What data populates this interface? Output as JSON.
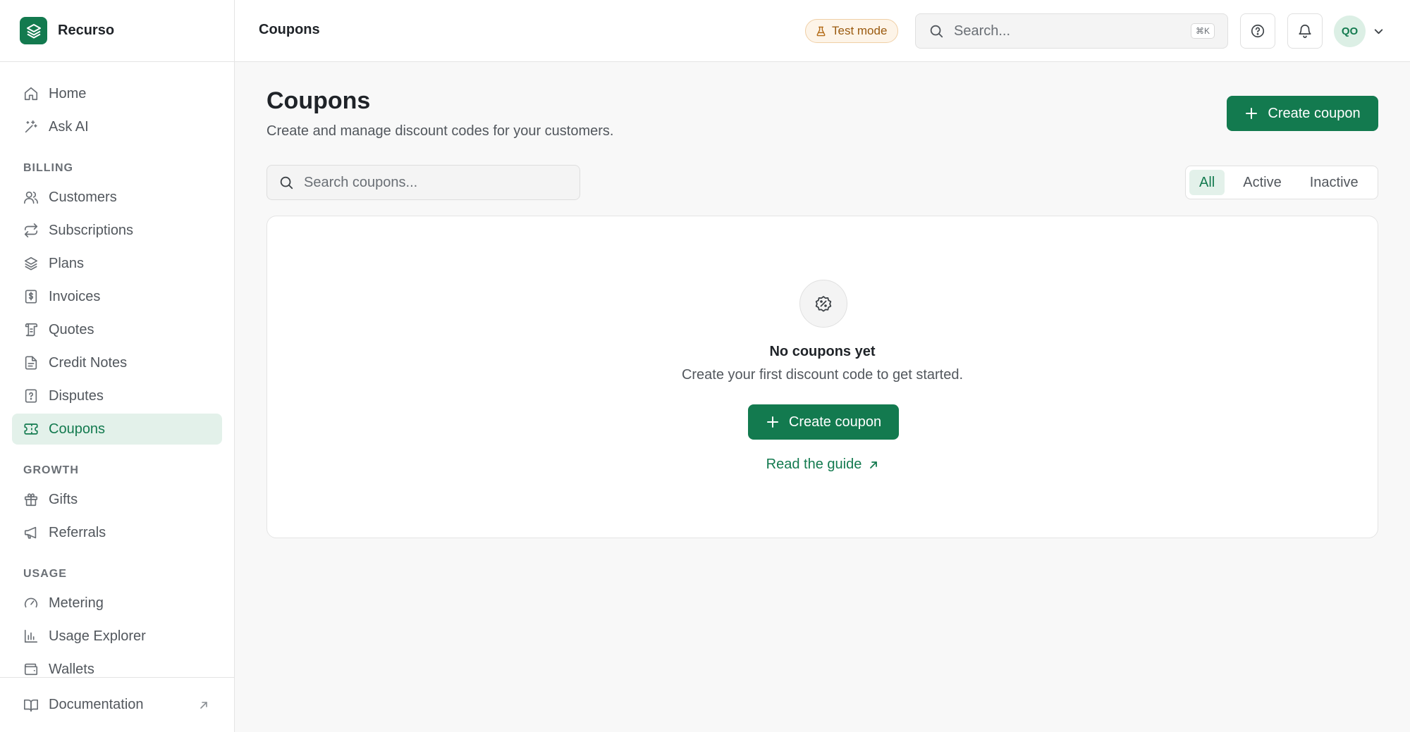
{
  "brand": {
    "name": "Recurso"
  },
  "sidebar": {
    "items": [
      {
        "label": "Home"
      },
      {
        "label": "Ask AI"
      }
    ],
    "sections": [
      {
        "title": "BILLING",
        "items": [
          {
            "label": "Customers"
          },
          {
            "label": "Subscriptions"
          },
          {
            "label": "Plans"
          },
          {
            "label": "Invoices"
          },
          {
            "label": "Quotes"
          },
          {
            "label": "Credit Notes"
          },
          {
            "label": "Disputes"
          },
          {
            "label": "Coupons",
            "active": true
          }
        ]
      },
      {
        "title": "GROWTH",
        "items": [
          {
            "label": "Gifts"
          },
          {
            "label": "Referrals"
          }
        ]
      },
      {
        "title": "USAGE",
        "items": [
          {
            "label": "Metering"
          },
          {
            "label": "Usage Explorer"
          },
          {
            "label": "Wallets"
          }
        ]
      }
    ],
    "footer": {
      "label": "Documentation"
    }
  },
  "topbar": {
    "title": "Coupons",
    "test_mode_label": "Test mode",
    "search_placeholder": "Search...",
    "search_shortcut": "⌘K",
    "avatar_initials": "QO"
  },
  "main": {
    "title": "Coupons",
    "subtitle": "Create and manage discount codes for your customers.",
    "create_button_label": "Create coupon",
    "search_placeholder": "Search coupons...",
    "filters": [
      "All",
      "Active",
      "Inactive"
    ],
    "active_filter": "All",
    "empty_state": {
      "title": "No coupons yet",
      "text": "Create your first discount code to get started.",
      "create_button_label": "Create coupon",
      "guide_link_label": "Read the guide"
    }
  },
  "colors": {
    "brand": "#137a4f",
    "active_bg": "#e3f1ea",
    "test_badge_text": "#9a5a0f",
    "test_badge_bg": "#fdf4e8"
  }
}
